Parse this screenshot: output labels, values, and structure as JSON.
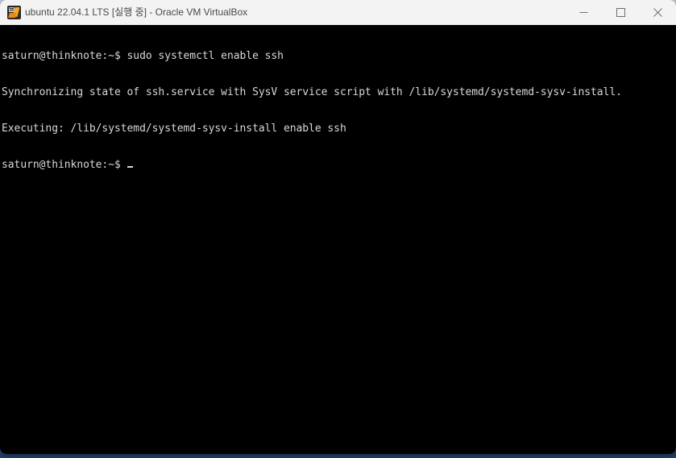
{
  "window": {
    "title": "ubuntu 22.04.1 LTS [실행 중] - Oracle VM VirtualBox",
    "icon": "virtualbox-icon",
    "controls": {
      "minimize_label": "−",
      "maximize_label": "□",
      "close_label": "✕"
    },
    "colors": {
      "titlebar_bg": "#f3f3f3",
      "title_text": "#4a4a4a",
      "control_glyph": "#6e6e6e",
      "terminal_bg": "#000000",
      "terminal_fg": "#d8d8d8",
      "desktop_bg": "#24406e"
    }
  },
  "terminal": {
    "prompt": "saturn@thinknote:~$",
    "user": "saturn",
    "host": "thinknote",
    "cwd": "~",
    "cursor": "_",
    "lines": [
      "saturn@thinknote:~$ sudo systemctl enable ssh",
      "Synchronizing state of ssh.service with SysV service script with /lib/systemd/systemd-sysv-install.",
      "Executing: /lib/systemd/systemd-sysv-install enable ssh"
    ],
    "current_line": "saturn@thinknote:~$ "
  }
}
